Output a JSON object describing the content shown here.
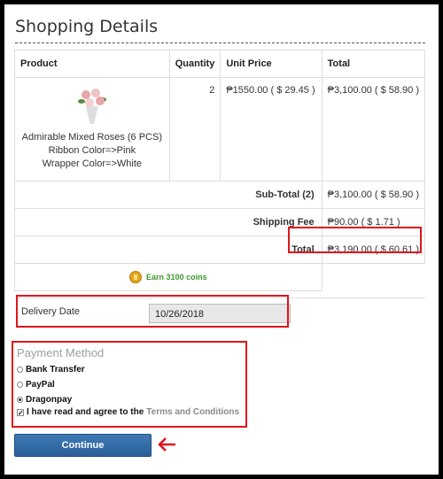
{
  "page": {
    "title": "Shopping Details"
  },
  "cart": {
    "headers": [
      "Product",
      "Quantity",
      "Unit Price",
      "Total"
    ],
    "item": {
      "name": "Admirable Mixed Roses (6 PCS)",
      "ribbon": "Ribbon Color=>Pink",
      "wrapper": "Wrapper Color=>White",
      "quantity": "2",
      "unit_price": "₱1550.00 ( $ 29.45 )",
      "total": "₱3,100.00 ( $ 58.90 )"
    },
    "summary": {
      "subtotal_label": "Sub-Total (2)",
      "subtotal_value": "₱3,100.00 ( $ 58.90 )",
      "shipping_label": "Shipping Fee",
      "shipping_value": "₱90.00 ( $ 1.71 )",
      "total_label": "Total",
      "total_value": "₱3,190.00 ( $ 60.61 )"
    },
    "coins_text": "Earn 3100 coins"
  },
  "delivery": {
    "label": "Delivery Date",
    "value": "10/26/2018"
  },
  "payment": {
    "title": "Payment Method",
    "options": [
      "Bank Transfer",
      "PayPal",
      "Dragonpay"
    ],
    "selected": "Dragonpay",
    "agree_text": "I have read and agree to the",
    "terms_link": "Terms and Conditions",
    "agree_checked": true
  },
  "actions": {
    "continue_label": "Continue"
  },
  "colors": {
    "highlight": "#e0151b",
    "button": "#2f6aa6",
    "coins": "#3c9a2c"
  }
}
